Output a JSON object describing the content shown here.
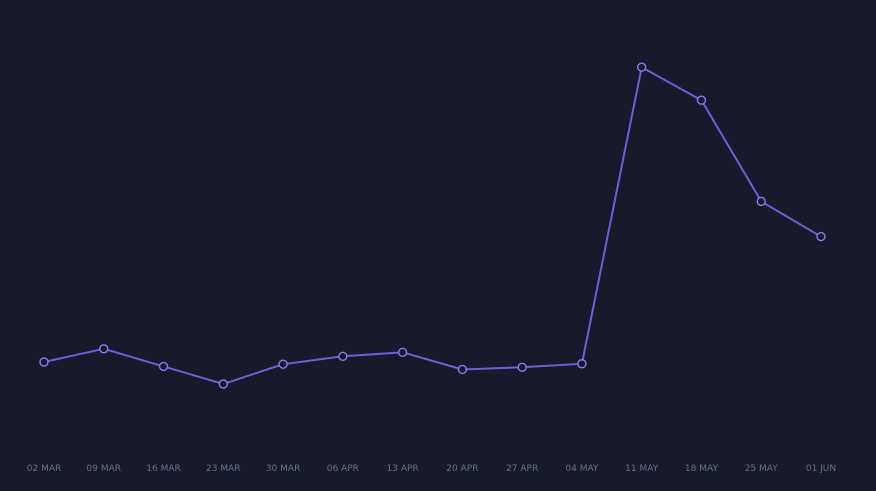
{
  "colors": {
    "background": "#161a2b",
    "line": "#6d5fd6",
    "point_stroke": "#8a7cf0",
    "point_fill": "#161a2b",
    "tick_label": "#6b7088"
  },
  "chart_data": {
    "type": "line",
    "title": "",
    "xlabel": "",
    "ylabel": "",
    "grid": false,
    "legend": "none",
    "categories": [
      "02 MAR",
      "09 MAR",
      "16 MAR",
      "23 MAR",
      "30 MAR",
      "06 APR",
      "13 APR",
      "20 APR",
      "27 APR",
      "04 MAY",
      "11 MAY",
      "18 MAY",
      "25 MAY",
      "01 JUN"
    ],
    "ylim": [
      0,
      100
    ],
    "series": [
      {
        "values": [
          20,
          23,
          19,
          15,
          19.5,
          21.3,
          22.2,
          18.3,
          18.8,
          19.6,
          87,
          79.5,
          56.5,
          48.5
        ]
      }
    ]
  }
}
